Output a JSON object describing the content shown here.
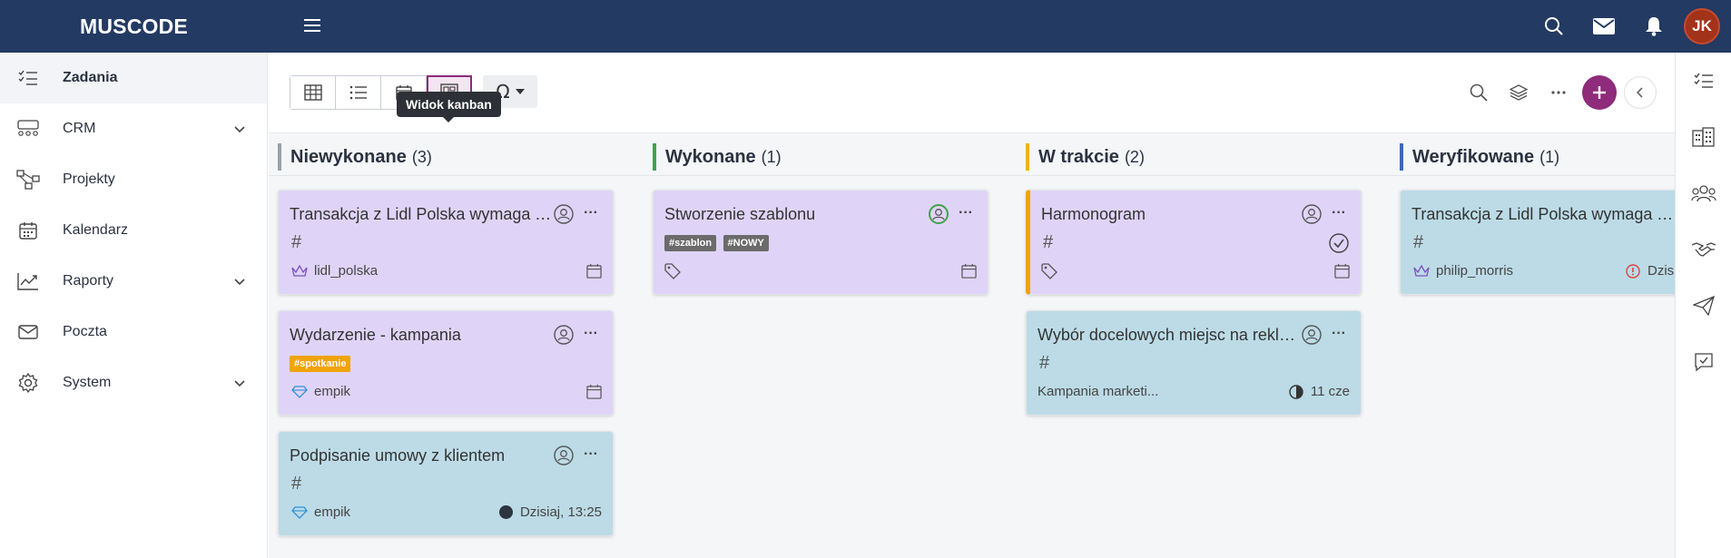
{
  "app": {
    "brand": "MUSCODE",
    "user_initials": "JK"
  },
  "sidebar": {
    "items": [
      {
        "label": "Zadania",
        "icon": "tasks-list-icon",
        "active": true,
        "expandable": false
      },
      {
        "label": "CRM",
        "icon": "crm-people-icon",
        "active": false,
        "expandable": true
      },
      {
        "label": "Projekty",
        "icon": "projects-flow-icon",
        "active": false,
        "expandable": false
      },
      {
        "label": "Kalendarz",
        "icon": "calendar-icon",
        "active": false,
        "expandable": false
      },
      {
        "label": "Raporty",
        "icon": "reports-chart-icon",
        "active": false,
        "expandable": true
      },
      {
        "label": "Poczta",
        "icon": "mail-icon",
        "active": false,
        "expandable": false
      },
      {
        "label": "System",
        "icon": "gear-icon",
        "active": false,
        "expandable": true
      }
    ]
  },
  "toolbar": {
    "tooltip": "Widok kanban",
    "views": [
      "table-view-icon",
      "list-view-icon",
      "calendar-view-icon",
      "kanban-view-icon"
    ],
    "active_view": 3,
    "omega": "Ω"
  },
  "columns": [
    {
      "name": "Niewykonane",
      "count": "(3)",
      "color": "#9aa0a6"
    },
    {
      "name": "Wykonane",
      "count": "(1)",
      "color": "#3fa34d"
    },
    {
      "name": "W trakcie",
      "count": "(2)",
      "color": "#f0b400"
    },
    {
      "name": "Weryfikowane",
      "count": "(1)",
      "color": "#3b6bb5"
    }
  ],
  "cards": {
    "c1": {
      "title": "Transakcja z Lidl Polska wymaga T...",
      "hash": "#",
      "client": "lidl_polska"
    },
    "c2": {
      "title": "Wydarzenie - kampania",
      "tag": "#spotkanie",
      "client": "empik"
    },
    "c3": {
      "title": "Podpisanie umowy z klientem",
      "hash": "#",
      "client": "empik",
      "due": "Dzisiaj, 13:25"
    },
    "c4": {
      "title": "Stworzenie szablonu",
      "tags": [
        "#szablon",
        "#NOWY"
      ]
    },
    "c5": {
      "title": "Harmonogram",
      "hash": "#"
    },
    "c6": {
      "title": "Wybór docelowych miejsc na rekla...",
      "hash": "#",
      "project": "Kampania marketi...",
      "due": "11 cze"
    },
    "c7": {
      "title": "Transakcja z Lidl Polska wymaga T...",
      "hash": "#",
      "client": "philip_morris",
      "due": "Dzis"
    }
  },
  "colors": {
    "topbar": "#233a62",
    "accent": "#8e2b7a",
    "card_purple": "#dfd4f7",
    "card_blue": "#bcdbe6",
    "tag_orange": "#f0a30a",
    "tag_gray": "#6b6b6b"
  }
}
